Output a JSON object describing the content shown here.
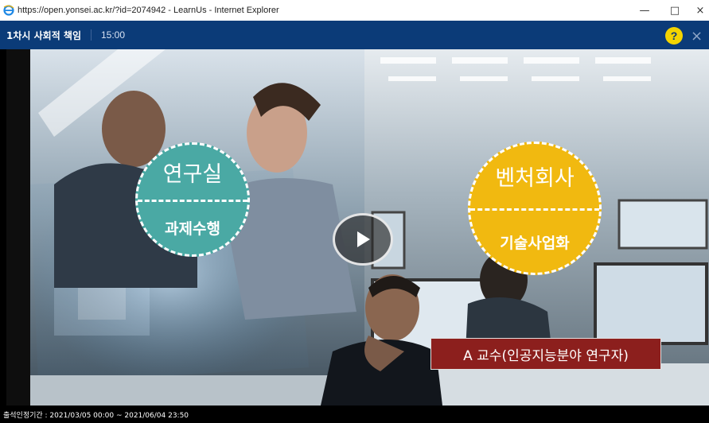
{
  "window": {
    "title": "https://open.yonsei.ac.kr/?id=2074942 - LearnUs - Internet Explorer",
    "icon": "ie-icon",
    "minimize_label": "—",
    "maximize_label": "□",
    "close_label": "×"
  },
  "header": {
    "lecture_title": "1차시 사회적 책임",
    "duration": "15:00",
    "help_label": "?",
    "close_label": "×"
  },
  "video": {
    "badge_left": {
      "top": "연구실",
      "bottom": "과제수행"
    },
    "badge_right": {
      "top": "벤처회사",
      "bottom": "기술사업화"
    },
    "caption": "A 교수(인공지능분야 연구자)",
    "play_icon": "play-icon"
  },
  "footer": {
    "attendance_period": "출석인정기간 : 2021/03/05 00:00 ~ 2021/06/04 23:50"
  },
  "colors": {
    "header_bg": "#0b3b78",
    "help_bg": "#f3d400",
    "badge_green": "#4aa9a4",
    "badge_yellow": "#f1b910",
    "caption_bg": "#8c1f1d"
  }
}
